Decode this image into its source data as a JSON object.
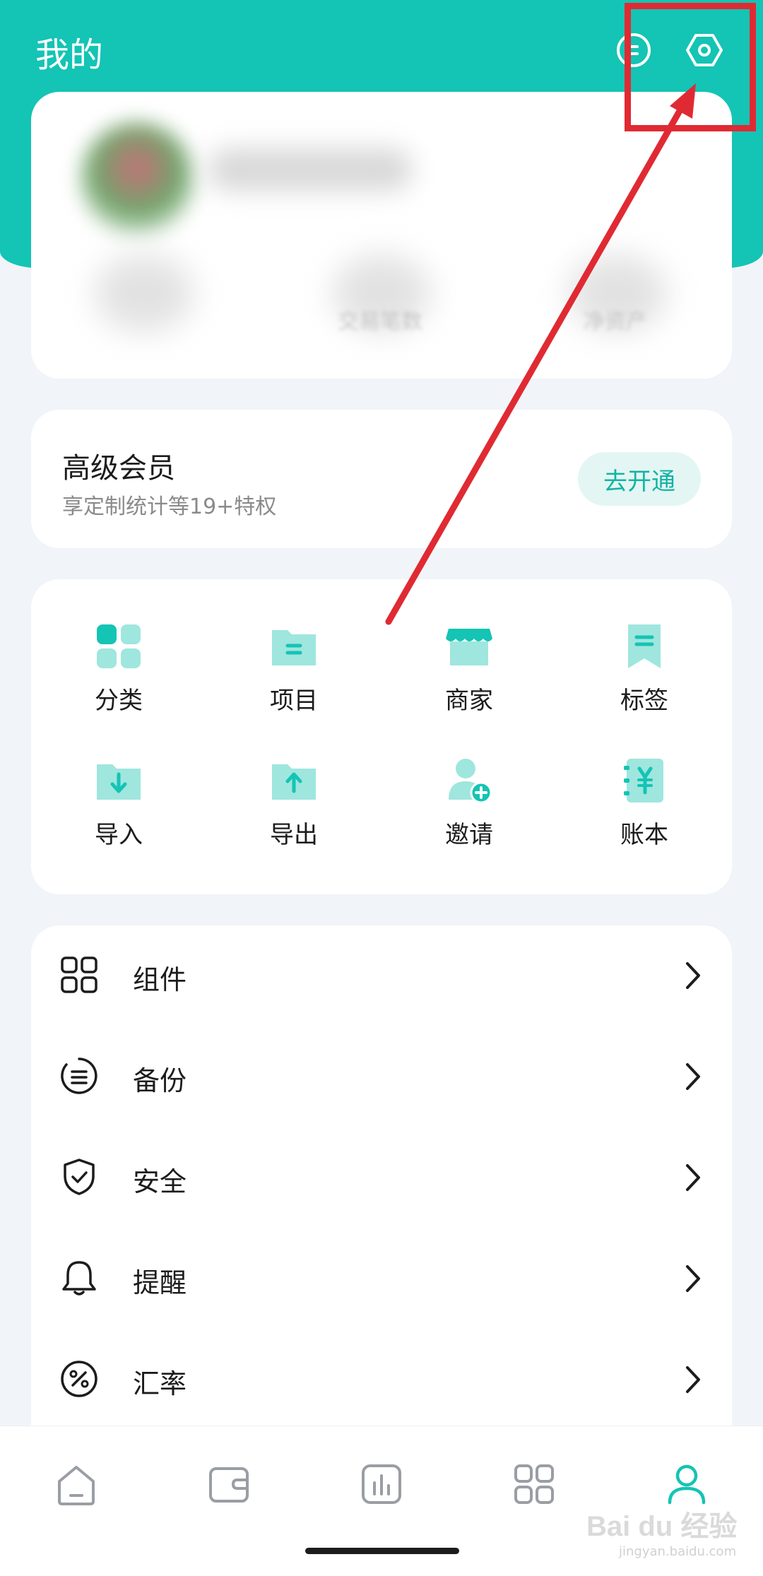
{
  "header": {
    "title": "我的",
    "message_icon": "message-icon",
    "settings_icon": "settings-hex-icon",
    "bg_color": "#14c4b4"
  },
  "profile": {
    "stat_label": "交易笔数",
    "stat_label_right": "净资产"
  },
  "vip": {
    "title": "高级会员",
    "subtitle": "享定制统计等19+特权",
    "button": "去开通"
  },
  "grid": {
    "items": [
      {
        "label": "分类",
        "icon": "category-icon"
      },
      {
        "label": "项目",
        "icon": "project-folder-icon"
      },
      {
        "label": "商家",
        "icon": "store-icon"
      },
      {
        "label": "标签",
        "icon": "tag-icon"
      },
      {
        "label": "导入",
        "icon": "import-icon"
      },
      {
        "label": "导出",
        "icon": "export-icon"
      },
      {
        "label": "邀请",
        "icon": "invite-icon"
      },
      {
        "label": "账本",
        "icon": "ledger-icon"
      }
    ]
  },
  "menu": {
    "items": [
      {
        "label": "组件",
        "icon": "widgets-icon"
      },
      {
        "label": "备份",
        "icon": "backup-icon"
      },
      {
        "label": "安全",
        "icon": "shield-icon"
      },
      {
        "label": "提醒",
        "icon": "bell-icon"
      },
      {
        "label": "汇率",
        "icon": "percent-icon"
      }
    ]
  },
  "tabbar": {
    "tabs": [
      {
        "name": "home",
        "icon": "home-icon"
      },
      {
        "name": "wallet",
        "icon": "wallet-icon"
      },
      {
        "name": "stats",
        "icon": "chart-icon"
      },
      {
        "name": "apps",
        "icon": "apps-grid-icon"
      },
      {
        "name": "me",
        "icon": "user-icon",
        "active": true
      }
    ],
    "active_color": "#14c4b4"
  },
  "watermark": {
    "text": "Bai du 经验",
    "sub": "jingyan.baidu.com"
  },
  "accent": "#14c4b4",
  "annotation_color": "#e02a33"
}
